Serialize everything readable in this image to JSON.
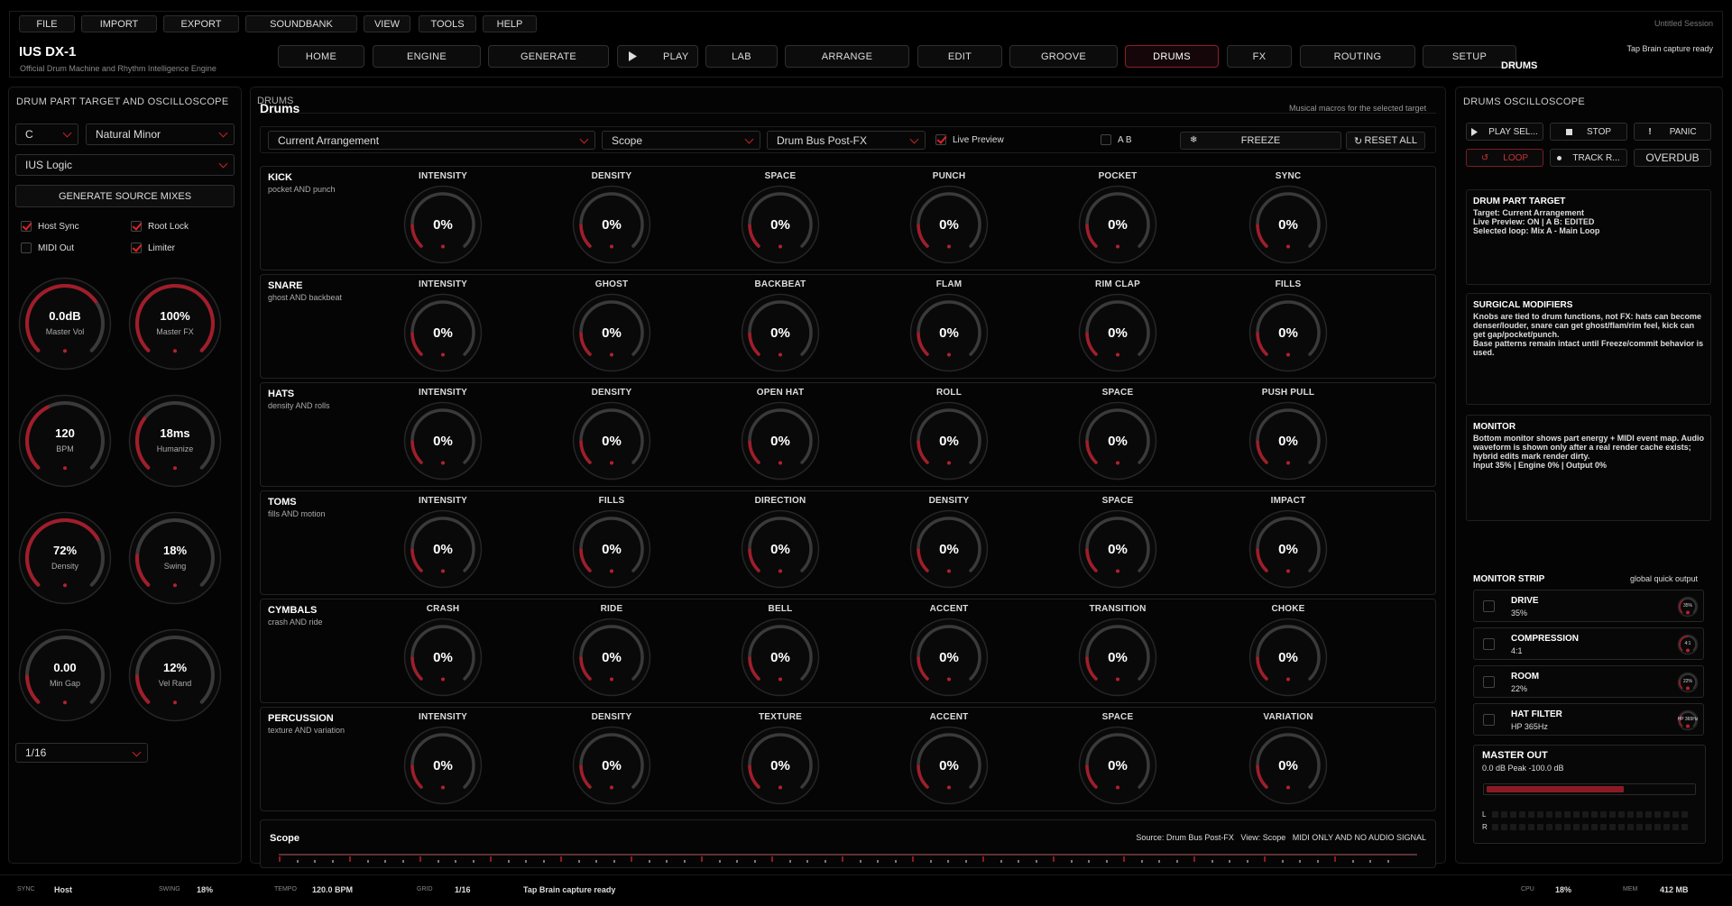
{
  "menu": {
    "items": [
      "FILE",
      "IMPORT",
      "EXPORT",
      "SOUNDBANK",
      "VIEW",
      "TOOLS",
      "HELP"
    ],
    "session": "Untitled Session"
  },
  "header": {
    "title": "IUS DX-1",
    "subtitle": "Official Drum Machine and Rhythm Intelligence Engine",
    "nav": [
      "HOME",
      "ENGINE",
      "GENERATE",
      "PLAY",
      "LAB",
      "ARRANGE",
      "EDIT",
      "GROOVE",
      "DRUMS",
      "FX",
      "ROUTING",
      "SETUP"
    ],
    "active_nav": "DRUMS",
    "context": "DRUMS",
    "tap_status": "Tap Brain capture ready"
  },
  "left": {
    "title": "DRUM PART TARGET AND OSCILLOSCOPE",
    "key": "C",
    "scale": "Natural Minor",
    "logic": "IUS Logic",
    "generate_label": "GENERATE SOURCE MIXES",
    "checks": [
      {
        "label": "Host Sync",
        "on": true
      },
      {
        "label": "Root Lock",
        "on": true
      },
      {
        "label": "MIDI Out",
        "on": false
      },
      {
        "label": "Limiter",
        "on": true
      }
    ],
    "knobs": [
      {
        "value": "0.0dB",
        "label": "Master Vol",
        "level": 0.7
      },
      {
        "value": "100%",
        "label": "Master FX",
        "level": 1.0
      },
      {
        "value": "120",
        "label": "BPM",
        "level": 0.4
      },
      {
        "value": "18ms",
        "label": "Humanize",
        "level": 0.3
      },
      {
        "value": "72%",
        "label": "Density",
        "level": 0.72
      },
      {
        "value": "18%",
        "label": "Swing",
        "level": 0.18
      },
      {
        "value": "0.00",
        "label": "Min Gap",
        "level": 0
      },
      {
        "value": "12%",
        "label": "Vel Rand",
        "level": 0.12
      }
    ],
    "grid": "1/16"
  },
  "main": {
    "section": "DRUMS",
    "title": "Drums",
    "subtitle": "Musical macros for the selected target",
    "target": "Current Arrangement",
    "view": "Scope",
    "source": "Drum Bus Post-FX",
    "live_preview": "Live Preview",
    "ab": "A B",
    "freeze": "FREEZE",
    "reset": "RESET ALL",
    "rows": [
      {
        "name": "KICK",
        "desc": "pocket AND punch",
        "params": [
          "INTENSITY",
          "DENSITY",
          "SPACE",
          "PUNCH",
          "POCKET",
          "SYNC"
        ]
      },
      {
        "name": "SNARE",
        "desc": "ghost AND backbeat",
        "params": [
          "INTENSITY",
          "GHOST",
          "BACKBEAT",
          "FLAM",
          "RIM CLAP",
          "FILLS"
        ]
      },
      {
        "name": "HATS",
        "desc": "density AND rolls",
        "params": [
          "INTENSITY",
          "DENSITY",
          "OPEN HAT",
          "ROLL",
          "SPACE",
          "PUSH PULL"
        ]
      },
      {
        "name": "TOMS",
        "desc": "fills AND motion",
        "params": [
          "INTENSITY",
          "FILLS",
          "DIRECTION",
          "DENSITY",
          "SPACE",
          "IMPACT"
        ]
      },
      {
        "name": "CYMBALS",
        "desc": "crash AND ride",
        "params": [
          "CRASH",
          "RIDE",
          "BELL",
          "ACCENT",
          "TRANSITION",
          "CHOKE"
        ]
      },
      {
        "name": "PERCUSSION",
        "desc": "texture AND variation",
        "params": [
          "INTENSITY",
          "DENSITY",
          "TEXTURE",
          "ACCENT",
          "SPACE",
          "VARIATION"
        ]
      }
    ],
    "knob_value": "0%",
    "scope": {
      "title": "Scope",
      "source": "Source: Drum Bus Post-FX",
      "view": "View: Scope",
      "mode": "MIDI ONLY AND NO AUDIO SIGNAL"
    }
  },
  "right": {
    "title": "DRUMS OSCILLOSCOPE",
    "buttons": [
      "PLAY SEL...",
      "STOP",
      "PANIC",
      "LOOP",
      "TRACK R...",
      "OVERDUB"
    ],
    "cards": [
      {
        "title": "DRUM PART TARGET",
        "lines": [
          "Target: Current Arrangement",
          "Live Preview: ON | A B: EDITED",
          "Selected loop: Mix A - Main Loop"
        ]
      },
      {
        "title": "SURGICAL MODIFIERS",
        "lines": [
          "Knobs are tied to drum functions, not FX: hats can become denser/louder, snare can get ghost/flam/rim feel, kick can get gap/pocket/punch.",
          "Base patterns remain intact until Freeze/commit behavior is used."
        ]
      },
      {
        "title": "MONITOR",
        "lines": [
          "Bottom monitor shows part energy + MIDI event map. Audio waveform is shown only after a real render cache exists; hybrid edits mark render dirty.",
          "Input 35% | Engine 0% | Output 0%"
        ]
      }
    ],
    "strip_title": "MONITOR STRIP",
    "strip_sub": "global quick output",
    "strip": [
      {
        "name": "DRIVE",
        "value": "35%",
        "mini": "35%",
        "level": 0.35
      },
      {
        "name": "COMPRESSION",
        "value": "4:1",
        "mini": "4:1",
        "level": 0.5
      },
      {
        "name": "ROOM",
        "value": "22%",
        "mini": "22%",
        "level": 0.22
      },
      {
        "name": "HAT FILTER",
        "value": "HP 365Hz",
        "mini": "HP 365Hz",
        "level": 0.3
      }
    ],
    "master": {
      "title": "MASTER OUT",
      "value": "0.0 dB   Peak -100.0 dB",
      "level": 0.66,
      "l": "L",
      "r": "R"
    }
  },
  "status": {
    "sync_key": "SYNC",
    "sync": "Host",
    "swing_key": "SWING",
    "swing": "18%",
    "tempo_key": "TEMPO",
    "tempo": "120.0 BPM",
    "grid_key": "GRID",
    "grid": "1/16",
    "message": "Tap Brain capture ready",
    "cpu_key": "CPU",
    "cpu": "18%",
    "mem_key": "MEM",
    "mem": "412 MB"
  },
  "colors": {
    "accent": "#b3222f",
    "panel": "#040404",
    "border": "#1d1d1d"
  }
}
